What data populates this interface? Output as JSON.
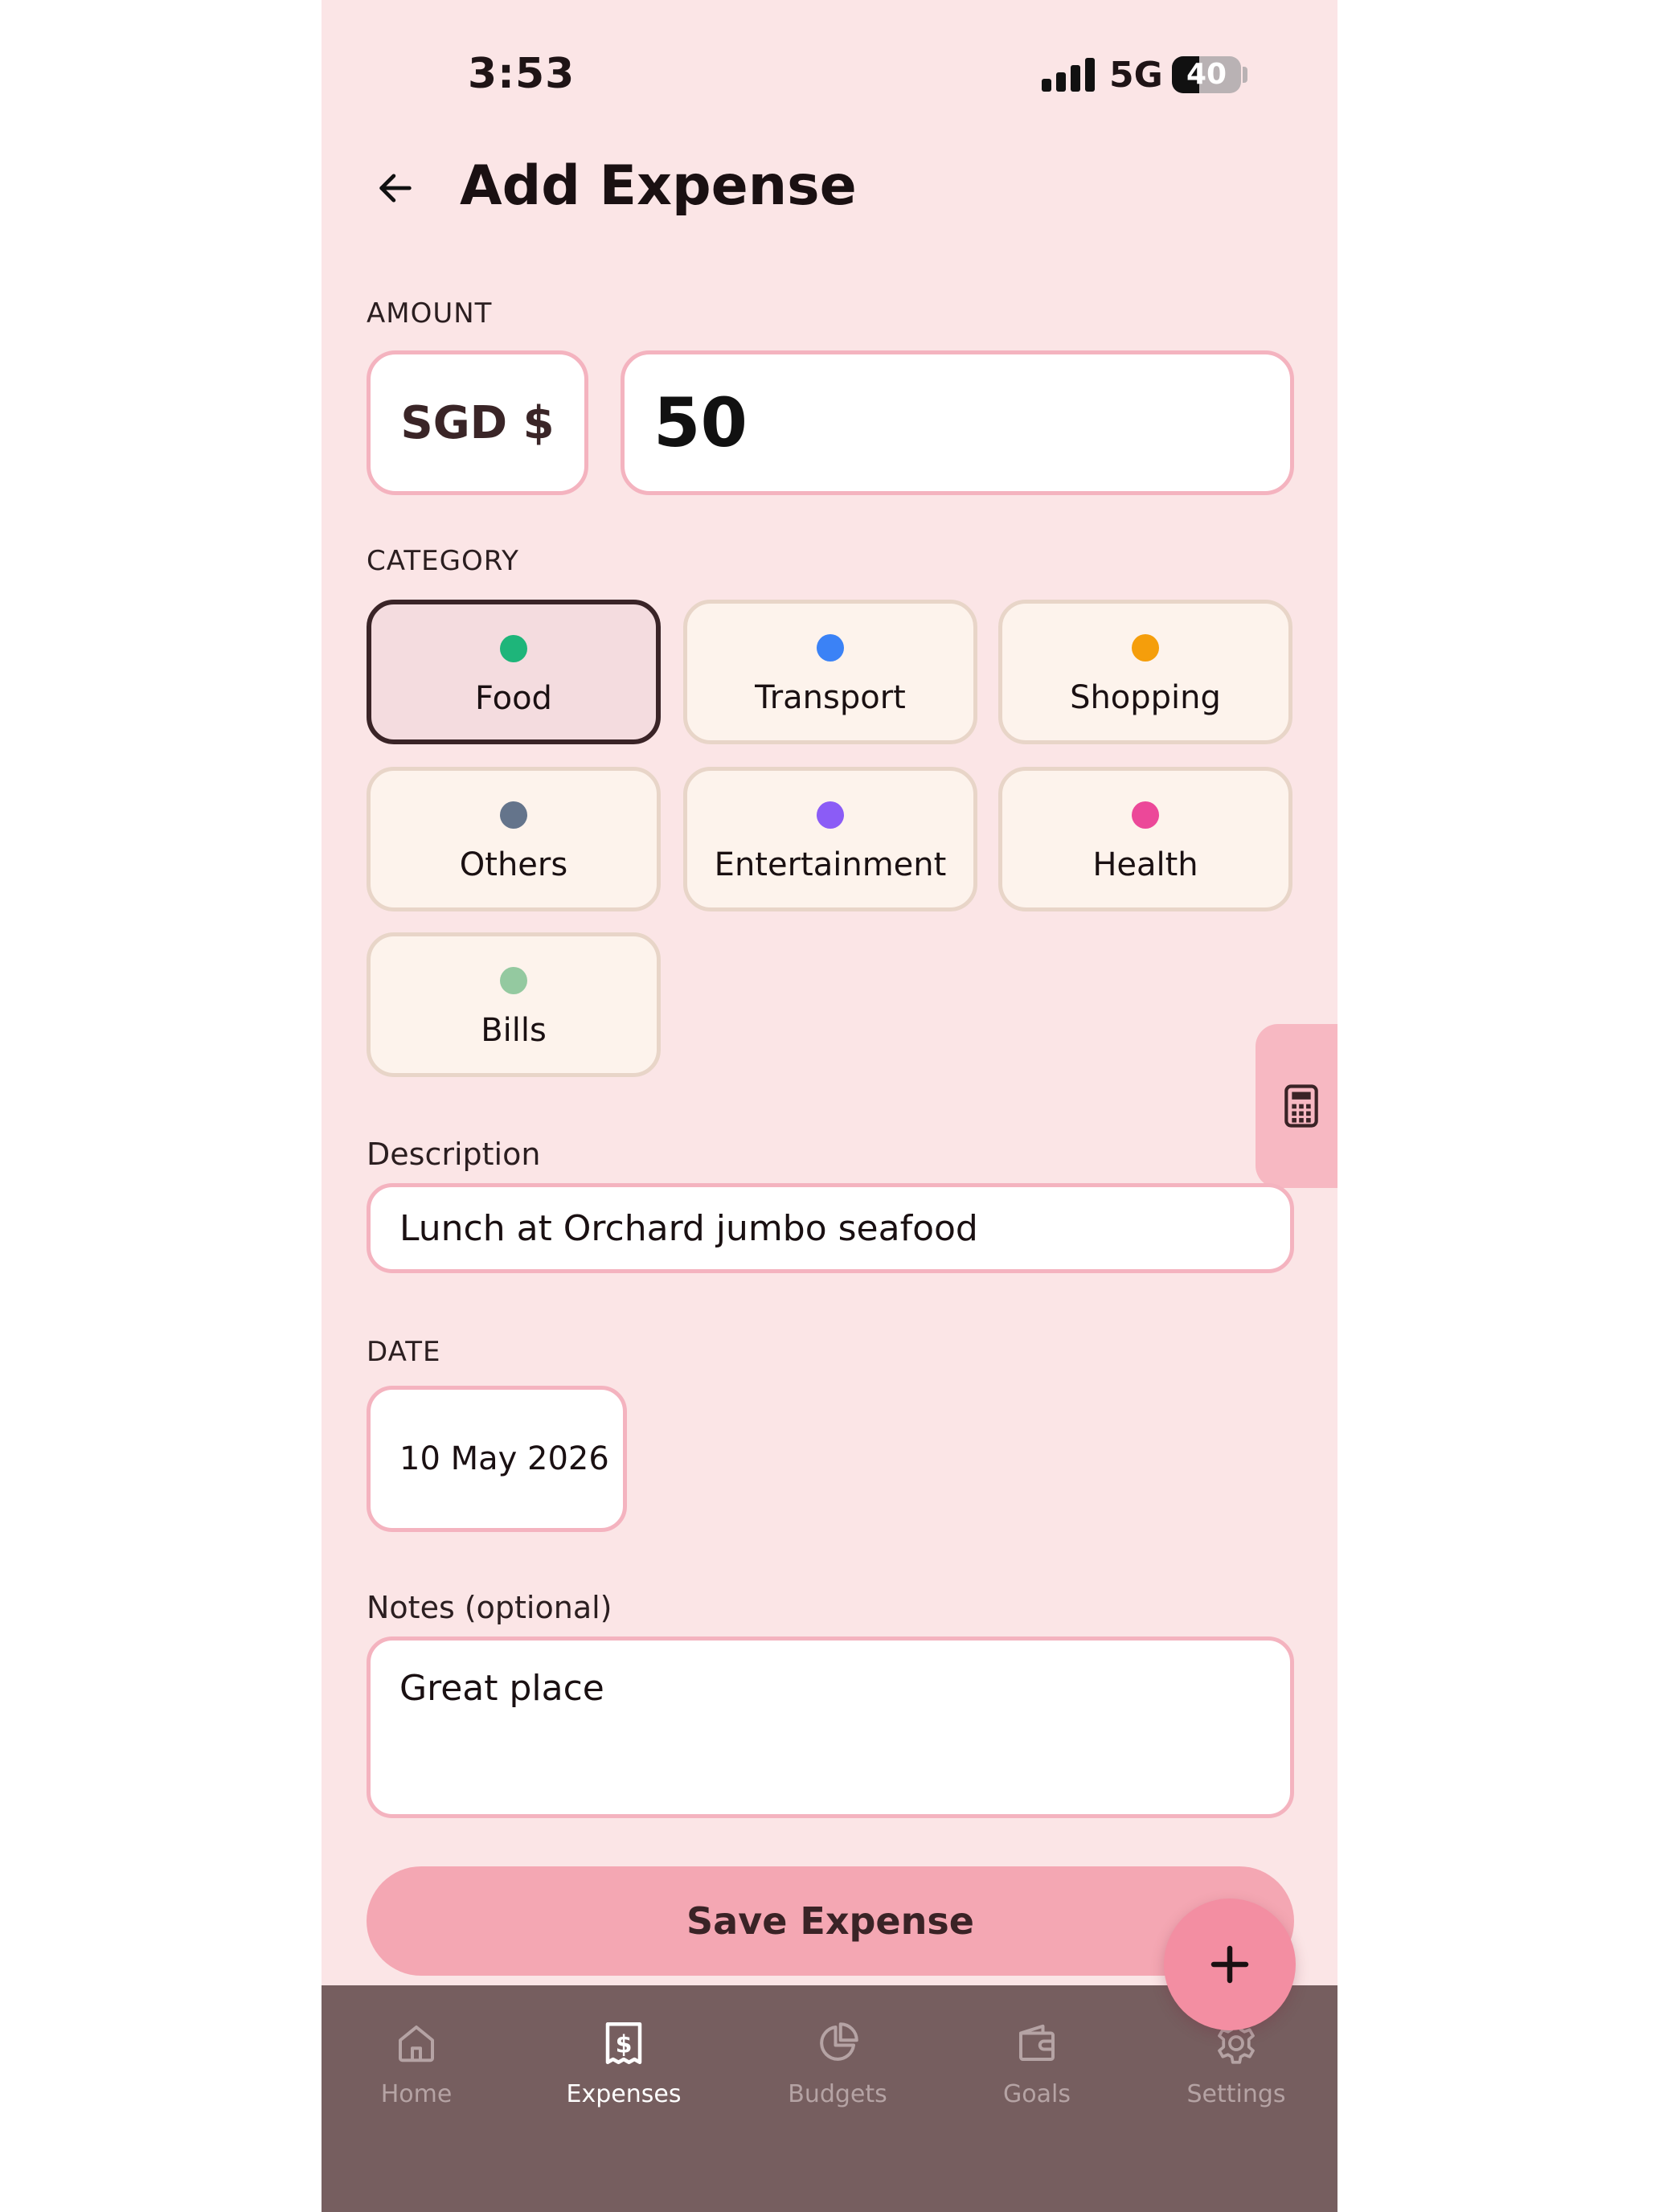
{
  "status_bar": {
    "time": "3:53",
    "network": "5G",
    "battery": "40",
    "battery_level": 0.4
  },
  "header": {
    "title": "Add Expense"
  },
  "amount": {
    "section_label": "AMOUNT",
    "currency": "SGD $",
    "value": "50"
  },
  "category": {
    "section_label": "CATEGORY",
    "items": [
      {
        "label": "Food",
        "color": "#1eb57a",
        "selected": true
      },
      {
        "label": "Transport",
        "color": "#3b82f6",
        "selected": false
      },
      {
        "label": "Shopping",
        "color": "#f59e0b",
        "selected": false
      },
      {
        "label": "Others",
        "color": "#64748b",
        "selected": false
      },
      {
        "label": "Entertainment",
        "color": "#8b5cf6",
        "selected": false
      },
      {
        "label": "Health",
        "color": "#ec4899",
        "selected": false
      },
      {
        "label": "Bills",
        "color": "#94c9a0",
        "selected": false
      }
    ]
  },
  "description": {
    "label": "Description",
    "value": "Lunch at Orchard jumbo seafood"
  },
  "date": {
    "section_label": "DATE",
    "value": "10 May 2026"
  },
  "notes": {
    "label": "Notes (optional)",
    "value": "Great place"
  },
  "save_button": {
    "label": "Save Expense"
  },
  "bottom_nav": {
    "items": [
      {
        "label": "Home",
        "icon": "home-icon",
        "active": false
      },
      {
        "label": "Expenses",
        "icon": "receipt-dollar-icon",
        "active": true
      },
      {
        "label": "Budgets",
        "icon": "pie-chart-icon",
        "active": false
      },
      {
        "label": "Goals",
        "icon": "wallet-icon",
        "active": false
      },
      {
        "label": "Settings",
        "icon": "gear-icon",
        "active": false
      }
    ]
  },
  "colors": {
    "background": "#fbe5e6",
    "accent": "#f4a7b3",
    "border": "#f4b3bf",
    "nav": "#765e5f"
  }
}
